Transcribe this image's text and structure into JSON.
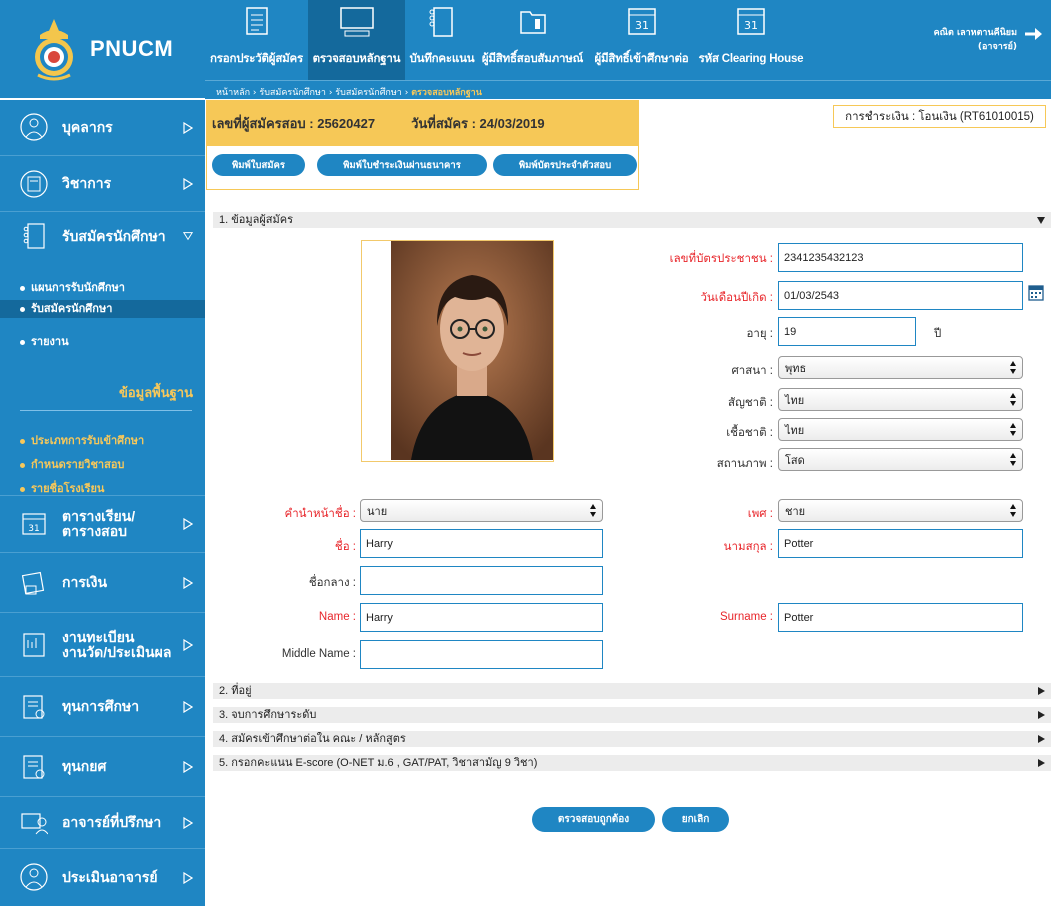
{
  "brand": {
    "name": "PNUCM"
  },
  "top_nav": [
    {
      "label": "กรอกประวัติผู้สมัคร",
      "icon": "document-icon"
    },
    {
      "label": "ตรวจสอบหลักฐาน",
      "icon": "computer-icon",
      "active": true
    },
    {
      "label": "บันทึกคะแนน",
      "icon": "notebook-icon"
    },
    {
      "label": "ผู้มีสิทธิ์สอบสัมภาษณ์",
      "icon": "folder-icon"
    },
    {
      "label": "ผู้มีสิทธิ์เข้าศึกษาต่อ",
      "icon": "calendar-icon"
    },
    {
      "label": "รหัส Clearing House",
      "icon": "calendar-icon"
    }
  ],
  "user": {
    "name": "คณิต เลาหตานคีนิยม",
    "role": "(อาจารย์)"
  },
  "breadcrumb": {
    "home": "หน้าหลัก",
    "sep": " › ",
    "level1": "รับสมัครนักศึกษา",
    "level2": "รับสมัครนักศึกษา",
    "current": "ตรวจสอบหลักฐาน"
  },
  "sidebar": {
    "items": [
      {
        "label": "บุคลากร"
      },
      {
        "label": "วิชาการ"
      },
      {
        "label": "รับสมัครนักศึกษา"
      },
      {
        "label": "ตารางเรียน/\nตารางสอบ"
      },
      {
        "label": "การเงิน"
      },
      {
        "label": "งานทะเบียน\nงานวัด/ประเมินผล"
      },
      {
        "label": "ทุนการศึกษา"
      },
      {
        "label": "ทุนกยศ"
      },
      {
        "label": "อาจารย์ที่ปรึกษา"
      },
      {
        "label": "ประเมินอาจารย์"
      }
    ],
    "submenu": [
      "แผนการรับนักศึกษา",
      "รับสมัครนักศึกษา",
      "รายงาน"
    ],
    "basic_title": "ข้อมูลพื้นฐาน",
    "basic_links": [
      "ประเภทการรับเข้าศึกษา",
      "กำหนดรายวิชาสอบ",
      "รายชื่อโรงเรียน"
    ]
  },
  "applicant": {
    "id_label": "เลขที่ผู้สมัครสอบ : 25620427",
    "date_label": "วันที่สมัคร : 24/03/2019",
    "payment": "การชำระเงิน : โอนเงิน (RT61010015)"
  },
  "print_buttons": [
    "พิมพ์ใบสมัคร",
    "พิมพ์ใบชำระเงินผ่านธนาคาร",
    "พิมพ์บัตรประจำตัวสอบ"
  ],
  "sections": [
    {
      "label": "1. ข้อมูลผู้สมัคร"
    },
    {
      "label": "2. ที่อยู่"
    },
    {
      "label": "3. จบการศึกษาระดับ"
    },
    {
      "label": "4. สมัครเข้าศึกษาต่อใน คณะ / หลักสูตร"
    },
    {
      "label": "5. กรอกคะแนน E-score (O-NET ม.6 , GAT/PAT, วิชาสามัญ 9 วิชา)"
    }
  ],
  "form": {
    "id_card": {
      "label": "เลขที่บัตรประชาชน :",
      "value": "2341235432123"
    },
    "birth_date": {
      "label": "วันเดือนปีเกิด :",
      "value": "01/03/2543"
    },
    "age": {
      "label": "อายุ :",
      "value": "19",
      "unit": "ปี"
    },
    "religion": {
      "label": "ศาสนา :",
      "value": "พุทธ"
    },
    "nationality": {
      "label": "สัญชาติ :",
      "value": "ไทย"
    },
    "ethnicity": {
      "label": "เชื้อชาติ :",
      "value": "ไทย"
    },
    "status": {
      "label": "สถานภาพ :",
      "value": "โสด"
    },
    "prefix": {
      "label": "คำนำหน้าชื่อ :",
      "value": "นาย"
    },
    "gender": {
      "label": "เพศ :",
      "value": "ชาย"
    },
    "first_name_th": {
      "label": "ชื่อ :",
      "value": "Harry"
    },
    "last_name_th": {
      "label": "นามสกุล :",
      "value": "Potter"
    },
    "middle_name_th": {
      "label": "ชื่อกลาง :",
      "value": ""
    },
    "first_name_en": {
      "label": "Name :",
      "value": "Harry"
    },
    "last_name_en": {
      "label": "Surname :",
      "value": "Potter"
    },
    "middle_name_en": {
      "label": "Middle Name :",
      "value": ""
    }
  },
  "actions": {
    "confirm": "ตรวจสอบถูกต้อง",
    "cancel": "ยกเลิก"
  },
  "colors": {
    "primary": "#1f86c3",
    "dark": "#14699c",
    "accent": "#f6c857",
    "required": "#e8262b"
  }
}
